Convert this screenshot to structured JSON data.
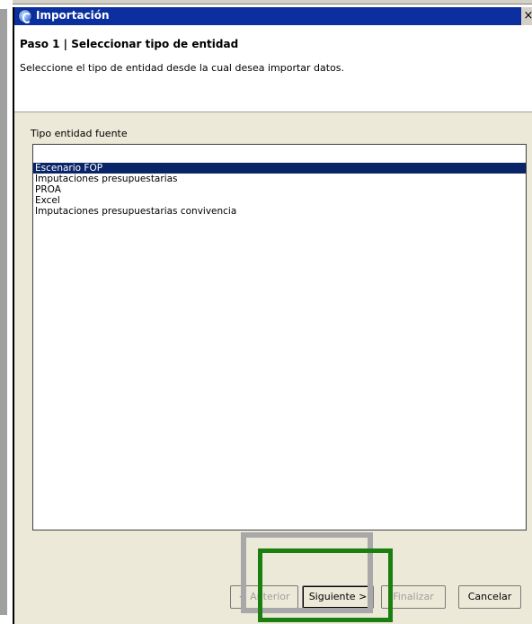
{
  "window": {
    "title": "Importación",
    "close_glyph": "×"
  },
  "header": {
    "step_title": "Paso 1 | Seleccionar tipo de entidad",
    "step_description": "Seleccione el tipo de entidad desde la cual desea importar datos."
  },
  "content": {
    "list_label": "Tipo entidad fuente",
    "items": [
      {
        "label": "Escenario FOP",
        "selected": true
      },
      {
        "label": "Imputaciones presupuestarias",
        "selected": false
      },
      {
        "label": "PROA",
        "selected": false
      },
      {
        "label": "Excel",
        "selected": false
      },
      {
        "label": "Imputaciones presupuestarias convivencia",
        "selected": false
      }
    ]
  },
  "buttons": {
    "prev": "< Anterior",
    "next": "Siguiente >",
    "finish": "Finalizar",
    "cancel": "Cancelar"
  },
  "colors": {
    "titlebar": "#0b2f9f",
    "selection": "#0a2468",
    "highlight_green": "#1a7f10",
    "highlight_gray": "#a8a8a8"
  },
  "icons": {
    "app": "globe-icon",
    "close": "close-icon"
  }
}
